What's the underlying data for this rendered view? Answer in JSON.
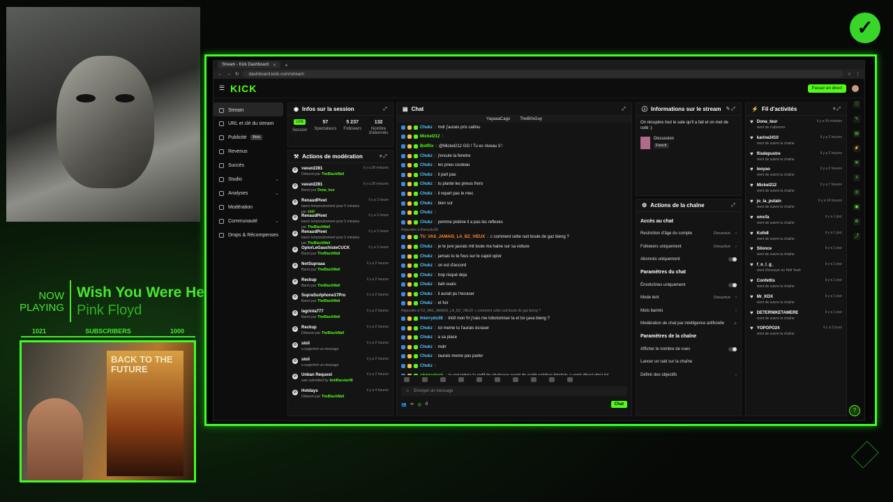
{
  "overlay": {
    "now_playing": "NOW PLAYING",
    "song": "Wish You Were Here",
    "artist": "Pink Floyd",
    "subs_left": "1021",
    "subs_label": "SUBSCRIBERS",
    "subs_right": "1000",
    "poster_text": "BACK TO THE FUTURE",
    "accent": "#49e632"
  },
  "browser": {
    "tab_title": "Stream - Kick Dashboard",
    "url": "dashboard.kick.com/stream"
  },
  "topbar": {
    "logo": "KICK",
    "go_live": "Passer en direct"
  },
  "sidebar": {
    "items": [
      {
        "label": "Stream",
        "icon": "stream-icon"
      },
      {
        "label": "URL et clé du stream",
        "icon": "key-icon"
      },
      {
        "label": "Publicité",
        "icon": "ad-icon",
        "badge": "Beta"
      },
      {
        "label": "Revenus",
        "icon": "revenue-icon"
      },
      {
        "label": "Succès",
        "icon": "trophy-icon"
      },
      {
        "label": "Studio",
        "icon": "studio-icon"
      },
      {
        "label": "Analyses",
        "icon": "analytics-icon"
      },
      {
        "label": "Modération",
        "icon": "shield-icon"
      },
      {
        "label": "Communauté",
        "icon": "community-icon"
      },
      {
        "label": "Drops & Récompenses",
        "icon": "gift-icon"
      }
    ]
  },
  "session": {
    "title": "Infos sur la session",
    "live": "LIVE",
    "session_label": "Session",
    "stats": [
      {
        "value": "57",
        "label": "Spectateurs"
      },
      {
        "value": "5 237",
        "label": "Followers"
      },
      {
        "value": "132",
        "label": "Nombre d'abonnés"
      }
    ]
  },
  "moderation": {
    "title": "Actions de modération",
    "items": [
      {
        "user": "vavan2281",
        "action": "Débanni par",
        "by": "TheBlackWall",
        "time": "il y a 28 minutes"
      },
      {
        "user": "vavan2281",
        "action": "Banni par",
        "by": "Dona_teur",
        "time": "il y a 28 minutes"
      },
      {
        "user": "RenaudPivet",
        "action": "banni temporairement pour 5 minutes par",
        "by": "sloli",
        "time": "il y a 1 heure"
      },
      {
        "user": "RenaudPivet",
        "action": "banni temporairement pour 5 minutes par",
        "by": "TheBlackWall",
        "time": "il y a 1 heure"
      },
      {
        "user": "RenaudPivet",
        "action": "banni temporairement pour 5 minutes par",
        "by": "TheBlackWall",
        "time": "il y a 1 heure"
      },
      {
        "user": "OpiorLeGauchisteCUCK",
        "action": "Banni par",
        "by": "TheBlackWall",
        "time": "il y a 1 heure"
      },
      {
        "user": "NotSupraaa",
        "action": "Banni par",
        "by": "TheBlackWall",
        "time": "il y a 2 heures"
      },
      {
        "user": "Reckup",
        "action": "Banni par",
        "by": "TheBlackWall",
        "time": "il y a 2 heures"
      },
      {
        "user": "SupraSurIphone17Pro",
        "action": "Banni par",
        "by": "TheBlackWall",
        "time": "il y a 2 heures"
      },
      {
        "user": "lagrinta777",
        "action": "Banni par",
        "by": "TheBlackWall",
        "time": "il y a 2 heures"
      },
      {
        "user": "Reckup",
        "action": "Débanni par",
        "by": "TheBlackWall",
        "time": "il y a 2 heures"
      },
      {
        "user": "sloli",
        "action": "a supprimé un message",
        "by": "",
        "time": "il y a 2 heures"
      },
      {
        "user": "sloli",
        "action": "a supprimé un message",
        "by": "",
        "time": "il y a 2 heures"
      },
      {
        "user": "Unban Request",
        "action": "was submitted by",
        "by": "AntiRacelar08",
        "time": "il y a 2 heures"
      },
      {
        "user": "Hotdays",
        "action": "Débanni par",
        "by": "TheBlackWall",
        "time": "il y a 4 heures"
      }
    ]
  },
  "chat": {
    "title": "Chat",
    "pinned": [
      "YayaaaCago",
      "TheB0sGuy"
    ],
    "messages": [
      {
        "name": "Chukz",
        "text": "mdr j'aurais pris caillou",
        "reply": ""
      },
      {
        "name": "Mickel212",
        "text": "",
        "reply": ""
      },
      {
        "name": "BotRix",
        "text": "@Mickel212 GG ! Tu es niveau 3 !",
        "reply": ""
      },
      {
        "name": "Chukz",
        "text": "j'encule la fenetre",
        "reply": ""
      },
      {
        "name": "Chukz",
        "text": "les pneu couteau",
        "reply": ""
      },
      {
        "name": "Chukz",
        "text": "il part pas",
        "reply": ""
      },
      {
        "name": "Chukz",
        "text": "tu plante les pneus frero",
        "reply": ""
      },
      {
        "name": "Chukz",
        "text": "il repart pas le mec",
        "reply": ""
      },
      {
        "name": "Chukz",
        "text": "bien sur",
        "reply": ""
      },
      {
        "name": "Chukz",
        "text": "",
        "reply": ""
      },
      {
        "name": "Chukz",
        "text": "pomme piskine il a pas les reflexes",
        "reply": ""
      },
      {
        "name": "TU_VAS_JAMAIS_LA_BZ_VIEUX",
        "text": "c comment cette nuit boule de gaz bieng ?",
        "reply": "Répondre à thierrydu38:"
      },
      {
        "name": "Chukz",
        "text": "je te jure jaurais mit toute ma haine sur sa voiture",
        "reply": ""
      },
      {
        "name": "Chukz",
        "text": "jamais tu te fous sur le capot opior",
        "reply": ""
      },
      {
        "name": "Chukz",
        "text": "on est d'accord",
        "reply": ""
      },
      {
        "name": "Chukz",
        "text": "trop risqué deja",
        "reply": ""
      },
      {
        "name": "Chukz",
        "text": "bah ouais",
        "reply": ""
      },
      {
        "name": "Chukz",
        "text": "il aurait pu t'ecraser",
        "reply": ""
      },
      {
        "name": "Chukz",
        "text": "et fuir",
        "reply": ""
      },
      {
        "name": "thierrydu38",
        "text": "trkill mon frr j'vais me lobotomiser la et toi çava bieng ?",
        "reply": "Répondre à TU_VAS_JAMAIS_LA_BZ_VIEUX: c comment cette nuit boule de gaz bieng ?"
      },
      {
        "name": "Chukz",
        "text": "toi meme tu l'aurais écraser",
        "reply": ""
      },
      {
        "name": "Chukz",
        "text": "a sa place",
        "reply": ""
      },
      {
        "name": "Chukz",
        "text": "mdrr",
        "reply": ""
      },
      {
        "name": "Chukz",
        "text": "taurais meme pas parler",
        "reply": ""
      },
      {
        "name": "Chukz",
        "text": "",
        "reply": ""
      },
      {
        "name": "shintaglock",
        "text": "tu regardera la redif du chateaux avant de partir yalabac hésitais a venir direct chez toi",
        "reply": ""
      }
    ],
    "placeholder": "Envoyer un message",
    "viewers": "∞",
    "points": "0",
    "send": "Chat"
  },
  "stream_info": {
    "title": "Informations sur le stream",
    "description": "On récupère tout le sale qu'il a fait et on met de coté :)",
    "category": "Discussion",
    "language": "French"
  },
  "channel": {
    "title": "Actions de la chaîne",
    "sections": [
      {
        "heading": "Accès au chat",
        "rows": [
          {
            "label": "Restriction d'âge du compte",
            "value": "Désactivé",
            "type": "chev"
          },
          {
            "label": "Followers uniquement",
            "value": "Désactivé",
            "type": "chev"
          },
          {
            "label": "Abonnés uniquement",
            "value": "",
            "type": "toggle"
          }
        ]
      },
      {
        "heading": "Paramètres du chat",
        "rows": [
          {
            "label": "Émoticônes uniquement",
            "value": "",
            "type": "toggle"
          },
          {
            "label": "Mode lent",
            "value": "Désactivé",
            "type": "chev"
          },
          {
            "label": "Mots bannis",
            "value": "",
            "type": "chev"
          },
          {
            "label": "Modération de chat par intelligence artificielle",
            "value": "",
            "type": "ext"
          }
        ]
      },
      {
        "heading": "Paramètres de la chaîne",
        "rows": [
          {
            "label": "Afficher le nombre de vues",
            "value": "",
            "type": "toggle"
          },
          {
            "label": "Lancer un raid sur la chaîne",
            "value": "",
            "type": "none"
          },
          {
            "label": "Définir des objectifs",
            "value": "",
            "type": "chev"
          }
        ]
      }
    ]
  },
  "activity": {
    "title": "Fil d'activités",
    "items": [
      {
        "user": "Dona_teur",
        "text": "vient de s'abonner",
        "time": "il y a 54 minutes"
      },
      {
        "user": "karine2410",
        "text": "vient de suivre la chaîne",
        "time": "il y a 2 heures"
      },
      {
        "user": "flisdepustre",
        "text": "vient de suivre la chaîne",
        "time": "il y a 2 heures"
      },
      {
        "user": "leoyao",
        "text": "vient de suivre la chaîne",
        "time": "il y a 2 heures"
      },
      {
        "user": "Mickel212",
        "text": "vient de suivre la chaîne",
        "time": "il y a 7 heures"
      },
      {
        "user": "jo_la_putain",
        "text": "vient de suivre la chaîne",
        "time": "il y a 14 heures"
      },
      {
        "user": "omcfa",
        "text": "vient de suivre la chaîne",
        "time": "il y a 1 jour"
      },
      {
        "user": "Kofo8",
        "text": "vient de suivre la chaîne",
        "time": "il y a 1 jour"
      },
      {
        "user": "Silonce",
        "text": "vient de suivre la chaîne",
        "time": "il y a 1 jour"
      },
      {
        "user": "f_o_l_g_",
        "text": "vient d'envoyer en Hell Yeah",
        "time": "il y a 1 jour"
      },
      {
        "user": "Confettis",
        "text": "vient de suivre la chaîne",
        "time": "il y a 1 jour"
      },
      {
        "user": "Mr_KDX",
        "text": "vient de suivre la chaîne",
        "time": "il y a 1 jour"
      },
      {
        "user": "DETERNIKETAMERE",
        "text": "vient de suivre la chaîne",
        "time": "il y a 1 jour"
      },
      {
        "user": "YOPOPO24",
        "text": "vient de suivre la chaîne",
        "time": "il y a 2 jours"
      }
    ]
  }
}
